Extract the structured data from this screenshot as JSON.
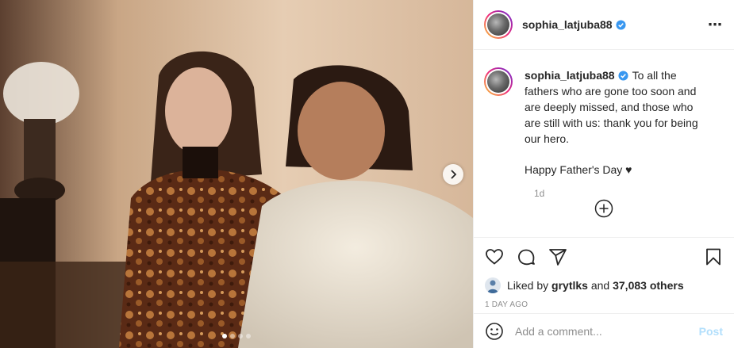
{
  "post": {
    "username": "sophia_latjuba88",
    "verified": true,
    "caption_text": "To all the fathers who are gone too soon and are deeply missed, and those who are still with us: thank you for being our hero.",
    "caption_line2": "Happy Father's Day ♥",
    "caption_age": "1d",
    "likes_prefix": "Liked by",
    "liked_by": "grytlks",
    "likes_joiner": "and",
    "likes_others": "37,083 others",
    "date": "1 DAY AGO",
    "carousel": {
      "count": 4,
      "active": 0
    }
  },
  "comment_box": {
    "placeholder": "Add a comment...",
    "post_label": "Post"
  },
  "icons": {
    "more": "more-options-icon",
    "verified": "verified-badge-icon",
    "like": "heart-icon",
    "comment": "comment-icon",
    "share": "paper-plane-icon",
    "save": "bookmark-icon",
    "load_more": "plus-circle-icon",
    "next": "chevron-right-icon",
    "emoji": "smiley-icon"
  },
  "colors": {
    "verified": "#3897f0",
    "post_disabled": "#b2dffc",
    "muted": "#8e8e8e"
  }
}
